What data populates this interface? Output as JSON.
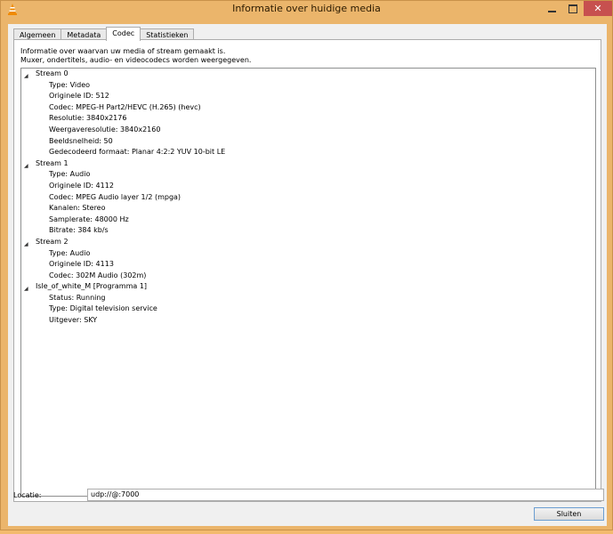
{
  "window": {
    "title": "Informatie over huidige media",
    "close_symbol": "✕"
  },
  "tabs": [
    {
      "label": "Algemeen"
    },
    {
      "label": "Metadata"
    },
    {
      "label": "Codec",
      "active": true
    },
    {
      "label": "Statistieken"
    }
  ],
  "codec": {
    "description_line1": "Informatie over waarvan uw media of stream gemaakt is.",
    "description_line2": "Muxer, ondertitels, audio- en videocodecs worden weergegeven.",
    "tree": [
      {
        "label": "Stream 0",
        "children": [
          "Type: Video",
          "Originele ID: 512",
          "Codec: MPEG-H Part2/HEVC (H.265) (hevc)",
          "Resolutie: 3840x2176",
          "Weergaveresolutie: 3840x2160",
          "Beeldsnelheid: 50",
          "Gedecodeerd formaat: Planar 4:2:2 YUV 10-bit LE"
        ]
      },
      {
        "label": "Stream 1",
        "children": [
          "Type: Audio",
          "Originele ID: 4112",
          "Codec: MPEG Audio layer 1/2 (mpga)",
          "Kanalen: Stereo",
          "Samplerate: 48000 Hz",
          "Bitrate: 384 kb/s"
        ]
      },
      {
        "label": "Stream 2",
        "children": [
          "Type: Audio",
          "Originele ID: 4113",
          "Codec: 302M Audio (302m)"
        ]
      },
      {
        "label": "Isle_of_white_M [Programma 1]",
        "children": [
          "Status: Running",
          "Type: Digital television service",
          "Uitgever: SKY"
        ]
      }
    ]
  },
  "location": {
    "label": "Locatie:",
    "value": "udp://@:7000"
  },
  "footer": {
    "close_label": "Sluiten"
  },
  "icons": {
    "app": "vlc-cone-icon",
    "expand": "expanded-triangle-icon"
  }
}
